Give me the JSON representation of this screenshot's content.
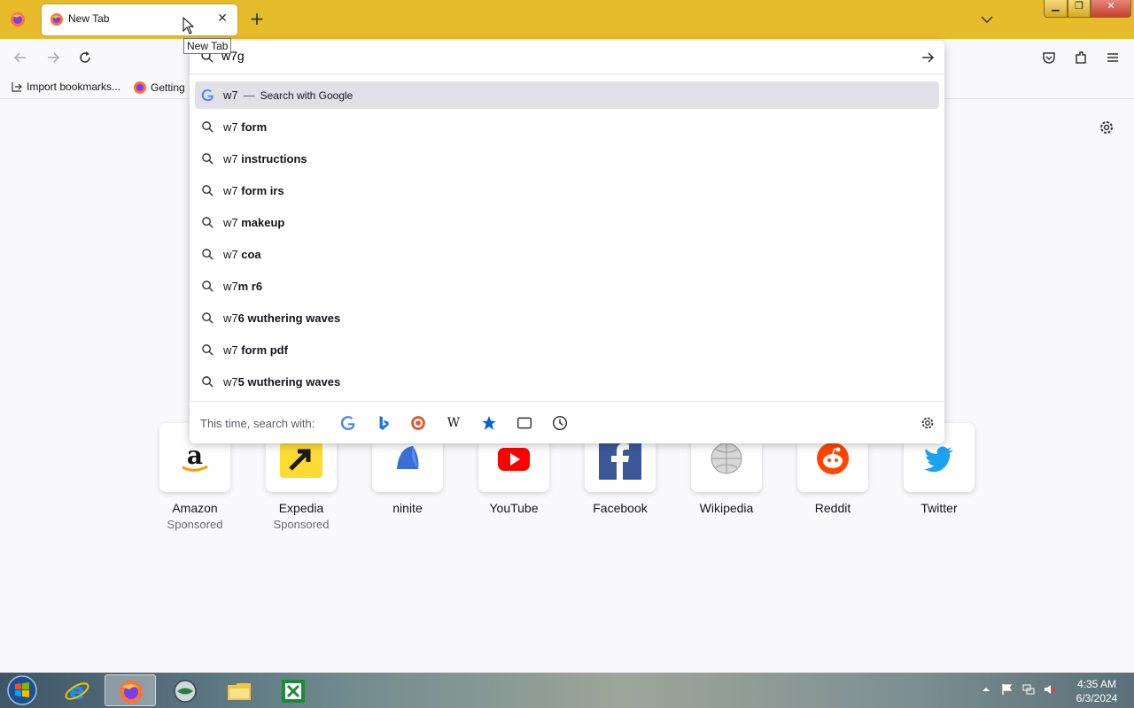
{
  "browser": {
    "tab": {
      "title": "New Tab",
      "tooltip": "New Tab"
    },
    "nav": {
      "back": "back-icon",
      "forward": "forward-icon",
      "reload": "reload-icon"
    },
    "urlbar": {
      "value": "w7g"
    },
    "bookmarks": [
      {
        "label": "Import bookmarks..."
      },
      {
        "label": "Getting"
      }
    ]
  },
  "suggestions": {
    "first": {
      "prefix": "w7",
      "action": "Search with Google"
    },
    "items": [
      {
        "prefix": "w7 ",
        "completion": "form"
      },
      {
        "prefix": "w7 ",
        "completion": "instructions"
      },
      {
        "prefix": "w7 ",
        "completion": "form irs"
      },
      {
        "prefix": "w7 ",
        "completion": "makeup"
      },
      {
        "prefix": "w7 ",
        "completion": "coa"
      },
      {
        "prefix": "w7",
        "completion": "m r6"
      },
      {
        "prefix": "w7",
        "completion": "6 wuthering waves"
      },
      {
        "prefix": "w7 ",
        "completion": "form pdf"
      },
      {
        "prefix": "w7",
        "completion": "5 wuthering waves"
      }
    ],
    "oneoff_label": "This time, search with:"
  },
  "tiles": [
    {
      "label": "Amazon",
      "sponsored": "Sponsored"
    },
    {
      "label": "Expedia",
      "sponsored": "Sponsored"
    },
    {
      "label": "ninite",
      "sponsored": ""
    },
    {
      "label": "YouTube",
      "sponsored": ""
    },
    {
      "label": "Facebook",
      "sponsored": ""
    },
    {
      "label": "Wikipedia",
      "sponsored": ""
    },
    {
      "label": "Reddit",
      "sponsored": ""
    },
    {
      "label": "Twitter",
      "sponsored": ""
    }
  ],
  "taskbar": {
    "time": "4:35 AM",
    "date": "6/3/2024"
  },
  "colors": {
    "titlebar": "#e6bc2c",
    "selected_suggestion": "#e0e0e6",
    "accent": "#0061e0"
  }
}
